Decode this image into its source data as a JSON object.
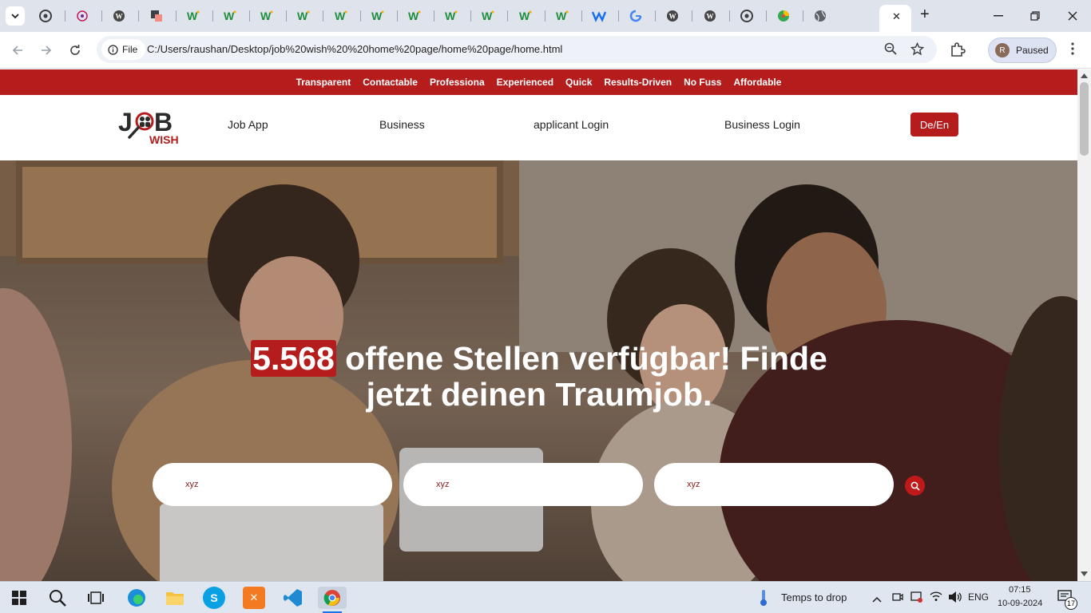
{
  "browser": {
    "tabs": [
      {
        "icon": "chrome-icon"
      },
      {
        "icon": "pink-circle-icon"
      },
      {
        "icon": "wordpress-icon"
      },
      {
        "icon": "notion-icon"
      },
      {
        "icon": "w-logo-icon"
      },
      {
        "icon": "w-logo-icon"
      },
      {
        "icon": "w-logo-icon"
      },
      {
        "icon": "w-logo-icon"
      },
      {
        "icon": "w-logo-icon"
      },
      {
        "icon": "w-logo-icon"
      },
      {
        "icon": "w-logo-icon"
      },
      {
        "icon": "w-logo-icon"
      },
      {
        "icon": "w-logo-icon"
      },
      {
        "icon": "w-logo-icon"
      },
      {
        "icon": "w-logo-icon"
      },
      {
        "icon": "webflow-icon"
      },
      {
        "icon": "google-icon"
      },
      {
        "icon": "wordpress-icon"
      },
      {
        "icon": "wordpress-icon"
      },
      {
        "icon": "chrome-icon"
      },
      {
        "icon": "green-yellow-icon"
      },
      {
        "icon": "globe-icon"
      }
    ],
    "active_tab_close": "✕",
    "new_tab": "+",
    "file_chip": "File",
    "url": "C:/Users/raushan/Desktop/job%20wish%20%20home%20page/home%20page/home.html",
    "profile_initial": "R",
    "profile_status": "Paused"
  },
  "site": {
    "topbar_items": [
      "Transparent",
      "Contactable",
      "Professiona",
      "Experienced",
      "Quick",
      "Results-Driven",
      "No Fuss",
      "Affordable"
    ],
    "logo": {
      "main": "J  B",
      "sub": "WISH"
    },
    "nav": {
      "job_app": "Job App",
      "business": "Business",
      "applicant_login": "applicant Login",
      "business_login": "Business Login",
      "lang": "De/En"
    },
    "hero": {
      "count": "5.568",
      "title_rest": " offene Stellen verfügbar! Finde jetzt deinen Traumjob."
    },
    "search": {
      "placeholder_1": "xyz",
      "placeholder_2": "xyz",
      "placeholder_3": "xyz"
    }
  },
  "taskbar": {
    "weather": "Temps to drop",
    "lang": "ENG",
    "time": "07:15",
    "date": "10-09-2024",
    "notifications": "17",
    "colors": {
      "accent": "#b51d1d"
    }
  }
}
